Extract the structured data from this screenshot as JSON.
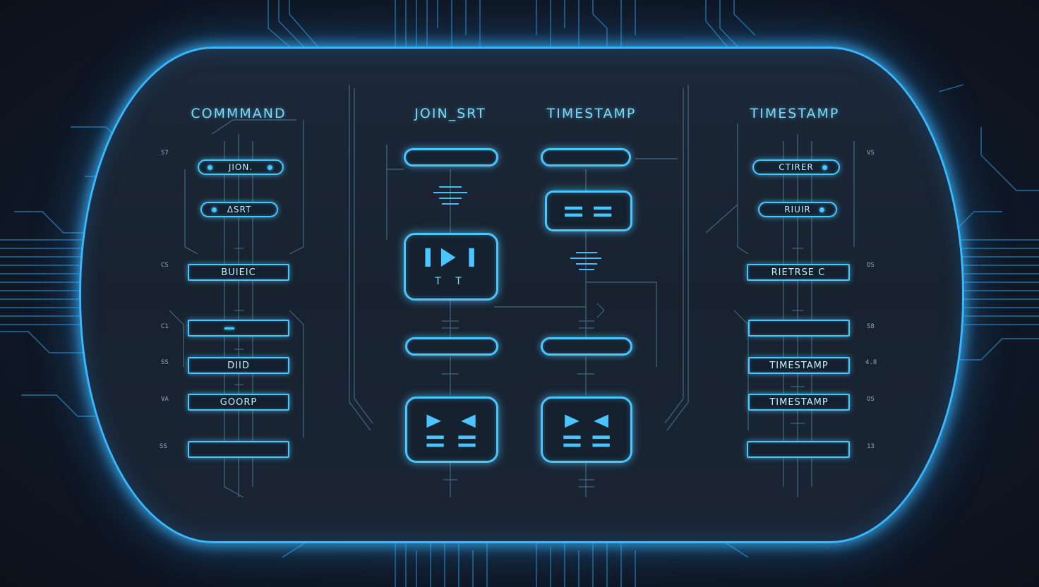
{
  "headers": {
    "col1": "COMMMAND",
    "col2": "JOIN_SRT",
    "col3": "TIMESTAMP",
    "col4": "TIMESTAMP"
  },
  "left_column": {
    "pill1": "JION.",
    "pill2": "ΔSRT",
    "btn1": "BUIEIC",
    "btn2": "",
    "btn3": "DIID",
    "btn4": "GOORP",
    "btn5": ""
  },
  "middle": {
    "play_tile_label": "T T"
  },
  "right_column": {
    "pill1": "CTIRER",
    "pill2": "RIUIR",
    "btn1": "RIETRSE C",
    "btn2": "",
    "btn3": "TIMESTAMP",
    "btn4": "TIMESTAMP",
    "btn5": ""
  },
  "side_numbers": {
    "left": [
      "S7",
      "CS",
      "C1",
      "SS",
      "VA",
      "SS"
    ],
    "right": [
      "VS",
      "OS",
      "S8",
      "4.8",
      "OS",
      "13"
    ]
  },
  "colors": {
    "accent": "#49c6ff",
    "glow": "#39b8ff",
    "panel": "#18222f",
    "background": "#111a28"
  },
  "icons": {
    "play_tile": "play-pause-icon",
    "rewind_tiles": "fast-forward-rewind-icon",
    "equal_tile": "equals-icon"
  }
}
